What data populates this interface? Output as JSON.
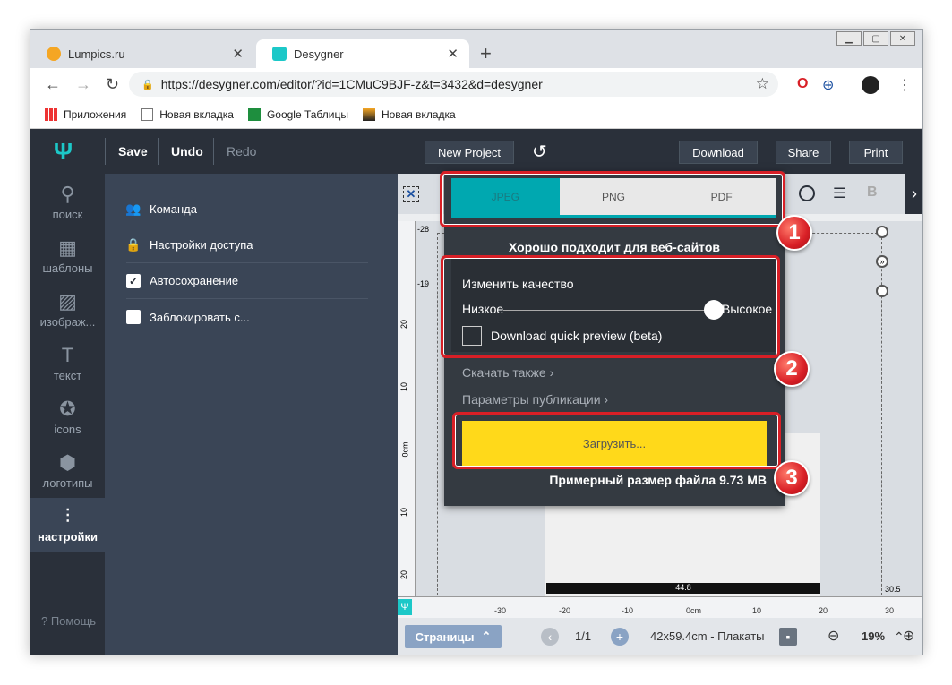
{
  "browser": {
    "tabs": [
      {
        "label": "Lumpics.ru"
      },
      {
        "label": "Desygner"
      }
    ],
    "url": "https://desygner.com/editor/?id=1CMuC9BJF-z&t=3432&d=desygner",
    "bookmarks": [
      {
        "label": "Приложения"
      },
      {
        "label": "Новая вкладка"
      },
      {
        "label": "Google Таблицы"
      },
      {
        "label": "Новая вкладка"
      }
    ]
  },
  "toolbar": {
    "save": "Save",
    "undo": "Undo",
    "redo": "Redo",
    "new_project": "New Project",
    "download": "Download",
    "share": "Share",
    "print": "Print"
  },
  "sidebar": {
    "items": [
      {
        "label": "поиск"
      },
      {
        "label": "шаблоны"
      },
      {
        "label": "изображ..."
      },
      {
        "label": "текст"
      },
      {
        "label": "icons"
      },
      {
        "label": "логотипы"
      },
      {
        "label": "настройки"
      }
    ],
    "help": "? Помощь"
  },
  "settings": {
    "items": [
      {
        "label": "Команда"
      },
      {
        "label": "Настройки доступа"
      },
      {
        "label": "Автосохранение"
      },
      {
        "label": "Заблокировать с..."
      }
    ]
  },
  "download_panel": {
    "formats": [
      "JPEG",
      "PNG",
      "PDF"
    ],
    "selected_format": "JPEG",
    "hint": "Хорошо подходит для веб-сайтов",
    "quality_label": "Изменить качество",
    "quality_low": "Низкое",
    "quality_high": "Высокое",
    "quality_value": 1.0,
    "quick_preview": "Download quick preview (beta)",
    "also": "Скачать также ›",
    "publish": "Параметры публикации ›",
    "download_button": "Загрузить...",
    "file_size": "Примерный размер файла 9.73 MB"
  },
  "badges": [
    "1",
    "2",
    "3"
  ],
  "rulers": {
    "left": [
      "-28",
      "-19",
      "20",
      "10",
      "0cm",
      "10",
      "20"
    ],
    "bottom": [
      "-30",
      "-20",
      "-10",
      "0cm",
      "10",
      "20",
      "30"
    ],
    "page_width": "44.8",
    "right": "30.5"
  },
  "status": {
    "pages": "Страницы",
    "page_count": "1/1",
    "size": "42x59.4cm - Плакаты",
    "zoom": "19%"
  }
}
